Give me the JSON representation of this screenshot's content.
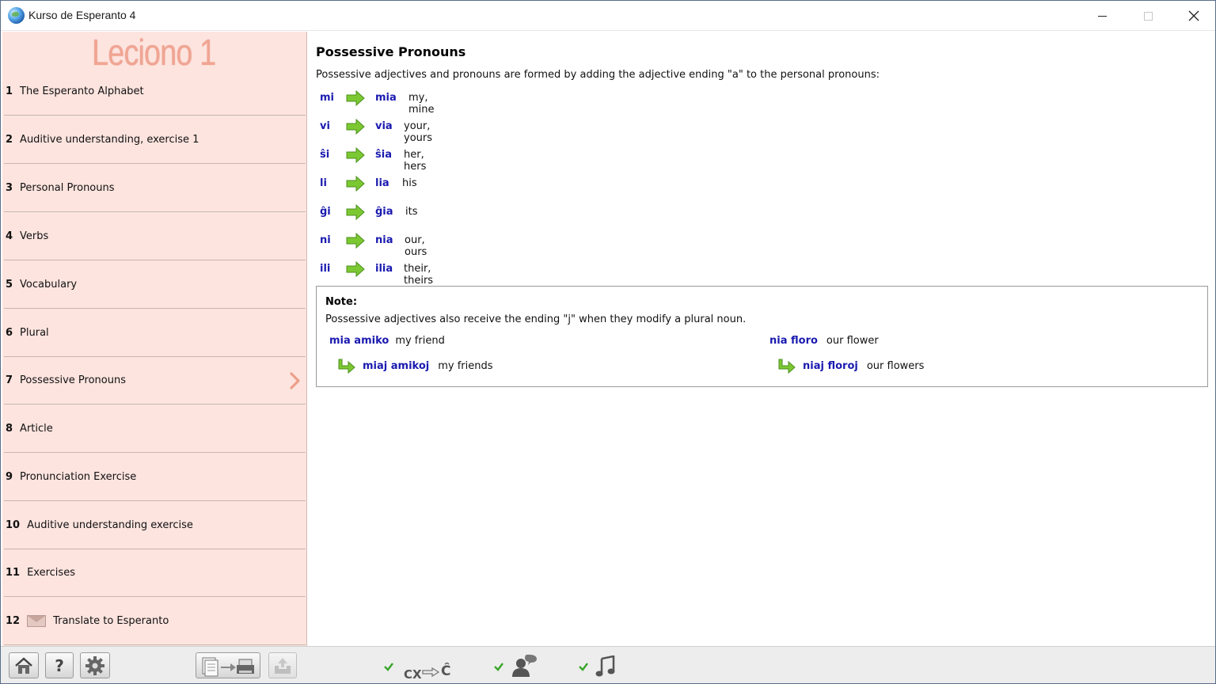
{
  "window": {
    "title": "Kurso de Esperanto 4"
  },
  "sidebar": {
    "lesson_title": "Leciono 1",
    "items": [
      {
        "num": "1",
        "label": "The Esperanto Alphabet"
      },
      {
        "num": "2",
        "label": "Auditive understanding, exercise 1"
      },
      {
        "num": "3",
        "label": "Personal Pronouns"
      },
      {
        "num": "4",
        "label": "Verbs"
      },
      {
        "num": "5",
        "label": "Vocabulary"
      },
      {
        "num": "6",
        "label": "Plural"
      },
      {
        "num": "7",
        "label": "Possessive Pronouns"
      },
      {
        "num": "8",
        "label": "Article"
      },
      {
        "num": "9",
        "label": "Pronunciation Exercise"
      },
      {
        "num": "10",
        "label": "Auditive understanding exercise"
      },
      {
        "num": "11",
        "label": "Exercises"
      },
      {
        "num": "12",
        "label": "Translate to Esperanto",
        "icon": "envelope-icon"
      }
    ],
    "active_index": 6
  },
  "content": {
    "heading": "Possessive Pronouns",
    "intro": "Possessive adjectives and pronouns are formed by adding the adjective ending \"a\" to the personal pronouns:",
    "pronouns": [
      {
        "src": "mi",
        "dst": "mia",
        "tr": "my, mine"
      },
      {
        "src": "vi",
        "dst": "via",
        "tr": "your, yours"
      },
      {
        "src": "ŝi",
        "dst": "ŝia",
        "tr": "her, hers"
      },
      {
        "src": "li",
        "dst": "lia",
        "tr": "his"
      },
      {
        "src": "ĝi",
        "dst": "ĝia",
        "tr": "its"
      },
      {
        "src": "ni",
        "dst": "nia",
        "tr": "our, ours"
      },
      {
        "src": "ili",
        "dst": "ilia",
        "tr": "their, theirs"
      }
    ],
    "note": {
      "title": "Note:",
      "text": "Possessive adjectives also receive the ending \"j\" when they modify a plural noun.",
      "examples": [
        {
          "eo": "mia amiko",
          "en": "my friend",
          "plural_eo": "miaj amikoj",
          "plural_en": "my friends"
        },
        {
          "eo": "nia floro",
          "en": "our flower",
          "plural_eo": "niaj floroj",
          "plural_en": "our flowers"
        }
      ]
    }
  },
  "toolbar": {
    "buttons": [
      "home-icon",
      "help-icon",
      "settings-icon",
      "print-icon",
      "export-icon"
    ],
    "cx_label": "CX",
    "cx_target": "Ĉ",
    "options": [
      "cx-conversion",
      "speaker",
      "music"
    ],
    "colors": {
      "check": "#3aa62a",
      "arrow": "#7cc832"
    }
  },
  "colors": {
    "sidebar_bg": "#fde4df",
    "esperanto_text": "#1a1ab0",
    "lesson_title": "#f0a593"
  }
}
